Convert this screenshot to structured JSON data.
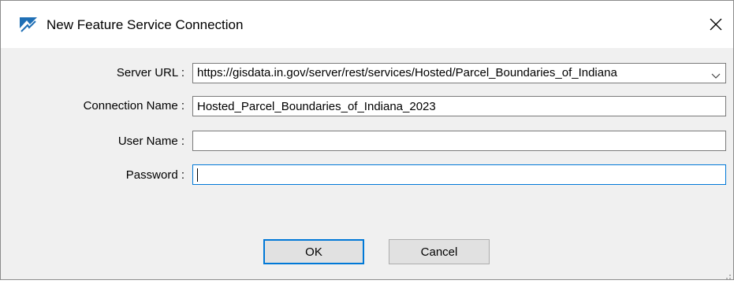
{
  "window": {
    "title": "New Feature Service Connection",
    "app_icon": "arcgis-pro-icon",
    "close_icon": "close-icon"
  },
  "form": {
    "server_url": {
      "label": "Server URL :",
      "value": "https://gisdata.in.gov/server/rest/services/Hosted/Parcel_Boundaries_of_Indiana"
    },
    "connection_name": {
      "label": "Connection Name :",
      "value": "Hosted_Parcel_Boundaries_of_Indiana_2023"
    },
    "user_name": {
      "label": "User Name :",
      "value": ""
    },
    "password": {
      "label": "Password :",
      "value": ""
    }
  },
  "buttons": {
    "ok_label": "OK",
    "cancel_label": "Cancel"
  },
  "colors": {
    "focus_border": "#0078d7",
    "dialog_background": "#f0f0f0"
  }
}
